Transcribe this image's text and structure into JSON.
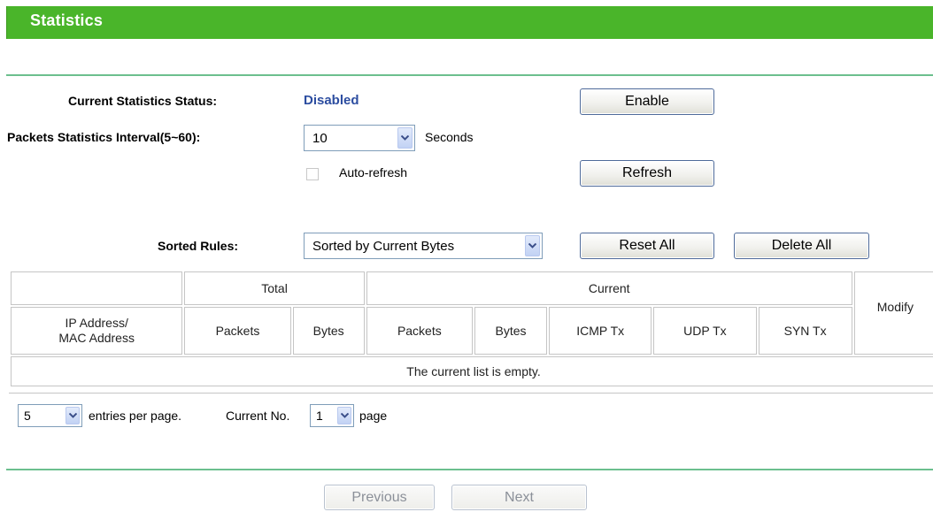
{
  "page": {
    "title": "Statistics"
  },
  "status": {
    "label": "Current Statistics Status:",
    "value": "Disabled",
    "enable_button": "Enable"
  },
  "interval": {
    "label": "Packets Statistics Interval(5~60):",
    "value": "10",
    "unit": "Seconds"
  },
  "auto_refresh": {
    "label": "Auto-refresh",
    "checked": false
  },
  "refresh_button": "Refresh",
  "sorted": {
    "label": "Sorted Rules:",
    "value": "Sorted by Current Bytes",
    "reset_all": "Reset All",
    "delete_all": "Delete All"
  },
  "table": {
    "group_total": "Total",
    "group_current": "Current",
    "modify": "Modify",
    "columns": [
      "IP Address/\nMAC Address",
      "Packets",
      "Bytes",
      "Packets",
      "Bytes",
      "ICMP Tx",
      "UDP Tx",
      "SYN Tx"
    ],
    "empty_message": "The current list is empty."
  },
  "pagination": {
    "entries_value": "5",
    "entries_text": "entries per page.",
    "current_no_label": "Current No.",
    "page_value": "1",
    "page_text": "page",
    "previous": "Previous",
    "next": "Next"
  },
  "colors": {
    "title_bar": "#4ab52a",
    "status_value": "#2c4da0",
    "divider": "#6cbf8e"
  }
}
